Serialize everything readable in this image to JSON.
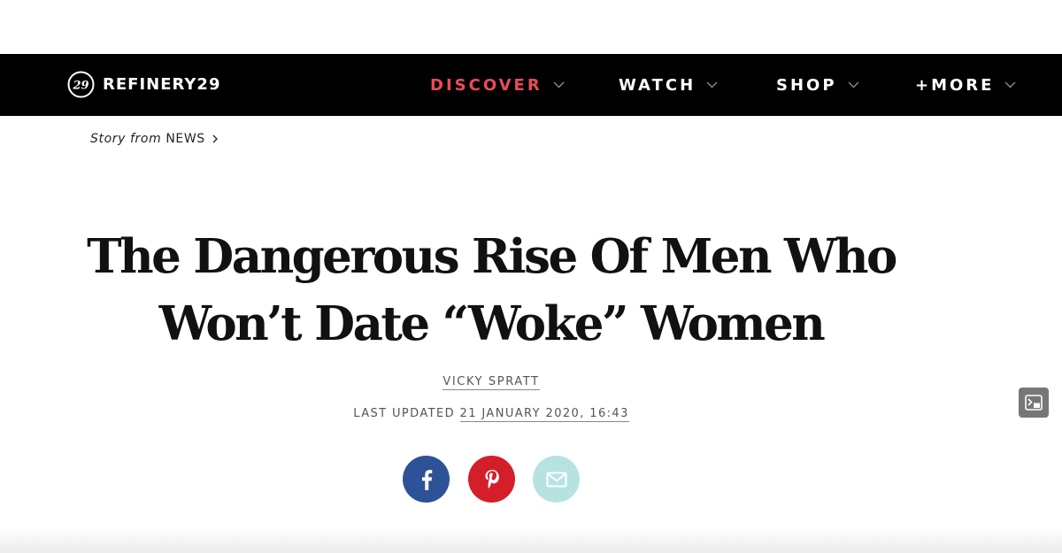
{
  "header": {
    "logo_text": "REFINERY29",
    "logo_mark": "29",
    "nav": [
      {
        "label": "DISCOVER",
        "active": true
      },
      {
        "label": "WATCH",
        "active": false
      },
      {
        "label": "SHOP",
        "active": false
      },
      {
        "label": "+MORE",
        "active": false
      }
    ]
  },
  "breadcrumb": {
    "prefix": "Story from",
    "section": "NEWS"
  },
  "article": {
    "headline_line1": "The Dangerous Rise Of Men Who",
    "headline_line2": "Won’t Date “Woke” Women",
    "author": "VICKY SPRATT",
    "updated_label": "LAST UPDATED",
    "updated_date": "21 JANUARY 2020, 16:43"
  },
  "share": {
    "buttons": [
      {
        "network": "facebook",
        "icon": "facebook-icon",
        "color": "#2e5297"
      },
      {
        "network": "pinterest",
        "icon": "pinterest-icon",
        "color": "#d41f2b"
      },
      {
        "network": "email",
        "icon": "envelope-icon",
        "color": "#b6e3e2"
      }
    ]
  },
  "overlay": {
    "pip_icon": "picture-in-picture-icon"
  },
  "colors": {
    "navbar_bg": "#000000",
    "active_nav": "#ea4b57",
    "headline": "#111111"
  }
}
